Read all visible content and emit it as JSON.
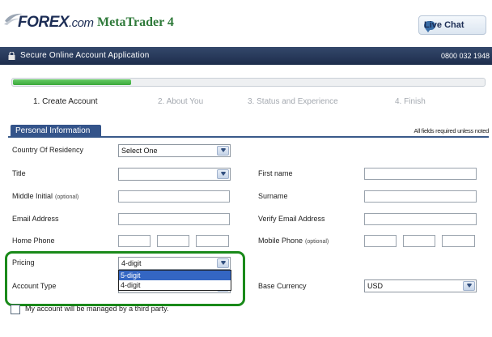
{
  "header": {
    "brand": "FOREX",
    "brand_suffix": ".com",
    "product": "MetaTrader 4",
    "live_chat": "Live Chat"
  },
  "titlebar": {
    "title": "Secure Online Account Application",
    "phone": "0800 032 1948"
  },
  "progress": {
    "fraction": 0.25
  },
  "steps": [
    "1. Create Account",
    "2. About You",
    "3. Status and Experience",
    "4. Finish"
  ],
  "section": {
    "tab": "Personal Information",
    "required_note": "All fields required unless noted"
  },
  "form": {
    "country_label": "Country Of Residency",
    "country_value": "Select One",
    "title_label": "Title",
    "title_value": "",
    "first_name_label": "First name",
    "middle_initial_label": "Middle Initial",
    "optional": "(optional)",
    "surname_label": "Surname",
    "email_label": "Email Address",
    "verify_email_label": "Verify Email Address",
    "home_phone_label": "Home Phone",
    "mobile_phone_label": "Mobile Phone",
    "pricing_label": "Pricing",
    "pricing_value": "4-digit",
    "pricing_options": [
      "5-digit",
      "4-digit"
    ],
    "account_type_label": "Account Type",
    "base_currency_label": "Base Currency",
    "base_currency_value": "USD",
    "third_party_label": "My account will be managed by a third party."
  },
  "colors": {
    "navy": "#1d2d4c",
    "section_blue": "#34548a",
    "progress_green": "#3aa83a",
    "highlight_green": "#1a8a1a",
    "selected_option": "#3466c3"
  }
}
